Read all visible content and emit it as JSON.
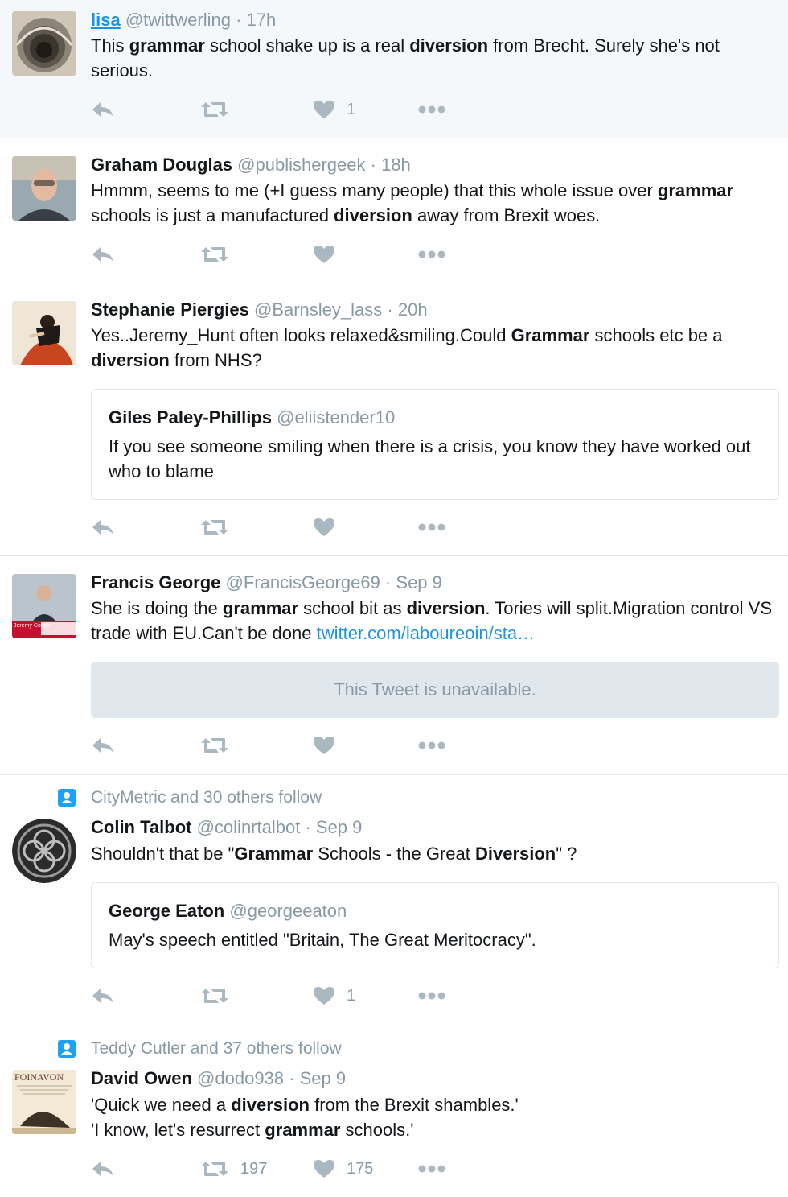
{
  "colors": {
    "link": "#1b95e0",
    "muted": "#8899a6",
    "icon": "#aab8c2",
    "divider": "#e1e8ed"
  },
  "tweets": [
    {
      "name": "lisa",
      "handle": "@twittwerling",
      "time": "· 17h",
      "text_parts": [
        {
          "t": "This "
        },
        {
          "t": "grammar",
          "b": true
        },
        {
          "t": " school shake up is a real "
        },
        {
          "t": "diversion",
          "b": true
        },
        {
          "t": " from Brecht. Surely she's not serious."
        }
      ],
      "likes": "1",
      "retweets": ""
    },
    {
      "name": "Graham Douglas",
      "handle": "@publishergeek",
      "time": "· 18h",
      "text_parts": [
        {
          "t": "Hmmm, seems to me (+I guess many people) that this whole issue over "
        },
        {
          "t": "grammar",
          "b": true
        },
        {
          "t": " schools is just a manufactured "
        },
        {
          "t": "diversion",
          "b": true
        },
        {
          "t": " away from Brexit woes."
        }
      ],
      "likes": "",
      "retweets": ""
    },
    {
      "name": "Stephanie Piergies",
      "handle": "@Barnsley_lass",
      "time": "· 20h",
      "text_parts": [
        {
          "t": "Yes..Jeremy_Hunt often looks relaxed&smiling.Could "
        },
        {
          "t": "Grammar",
          "b": true
        },
        {
          "t": " schools etc be a "
        },
        {
          "t": "diversion",
          "b": true
        },
        {
          "t": " from NHS?"
        }
      ],
      "quote": {
        "name": "Giles Paley-Phillips",
        "handle": "@eliistender10",
        "text": "If you see someone smiling when there is a crisis, you know they have worked out who to blame"
      },
      "likes": "",
      "retweets": ""
    },
    {
      "name": "Francis George",
      "handle": "@FrancisGeorge69",
      "time": "· Sep 9",
      "text_parts": [
        {
          "t": "She is doing the "
        },
        {
          "t": "grammar",
          "b": true
        },
        {
          "t": " school bit as "
        },
        {
          "t": "diversion",
          "b": true
        },
        {
          "t": ". Tories will split.Migration control VS trade with EU.Can't be done "
        },
        {
          "t": "twitter.com/laboureoin/sta…",
          "link": true
        }
      ],
      "unavailable": "This Tweet is unavailable.",
      "avatar_caption": "Jeremy Corbyn",
      "likes": "",
      "retweets": ""
    },
    {
      "social": "CityMetric and 30 others follow",
      "name": "Colin Talbot",
      "handle": "@colinrtalbot",
      "time": "· Sep 9",
      "text_parts": [
        {
          "t": "Shouldn't that be \""
        },
        {
          "t": "Grammar",
          "b": true
        },
        {
          "t": " Schools - the Great "
        },
        {
          "t": "Diversion",
          "b": true
        },
        {
          "t": "\" ?"
        }
      ],
      "quote": {
        "name": "George Eaton",
        "handle": "@georgeeaton",
        "text": "May's speech entitled \"Britain, The Great Meritocracy\"."
      },
      "likes": "1",
      "retweets": ""
    },
    {
      "social": "Teddy Cutler and 37 others follow",
      "name": "David Owen",
      "handle": "@dodo938",
      "time": "· Sep 9",
      "text_parts": [
        {
          "t": "'Quick we need a "
        },
        {
          "t": "diversion",
          "b": true
        },
        {
          "t": " from the Brexit shambles.'\n'I know, let's resurrect "
        },
        {
          "t": "grammar",
          "b": true
        },
        {
          "t": " schools.'"
        }
      ],
      "avatar_caption": "FOINAVON",
      "likes": "175",
      "retweets": "197"
    }
  ]
}
